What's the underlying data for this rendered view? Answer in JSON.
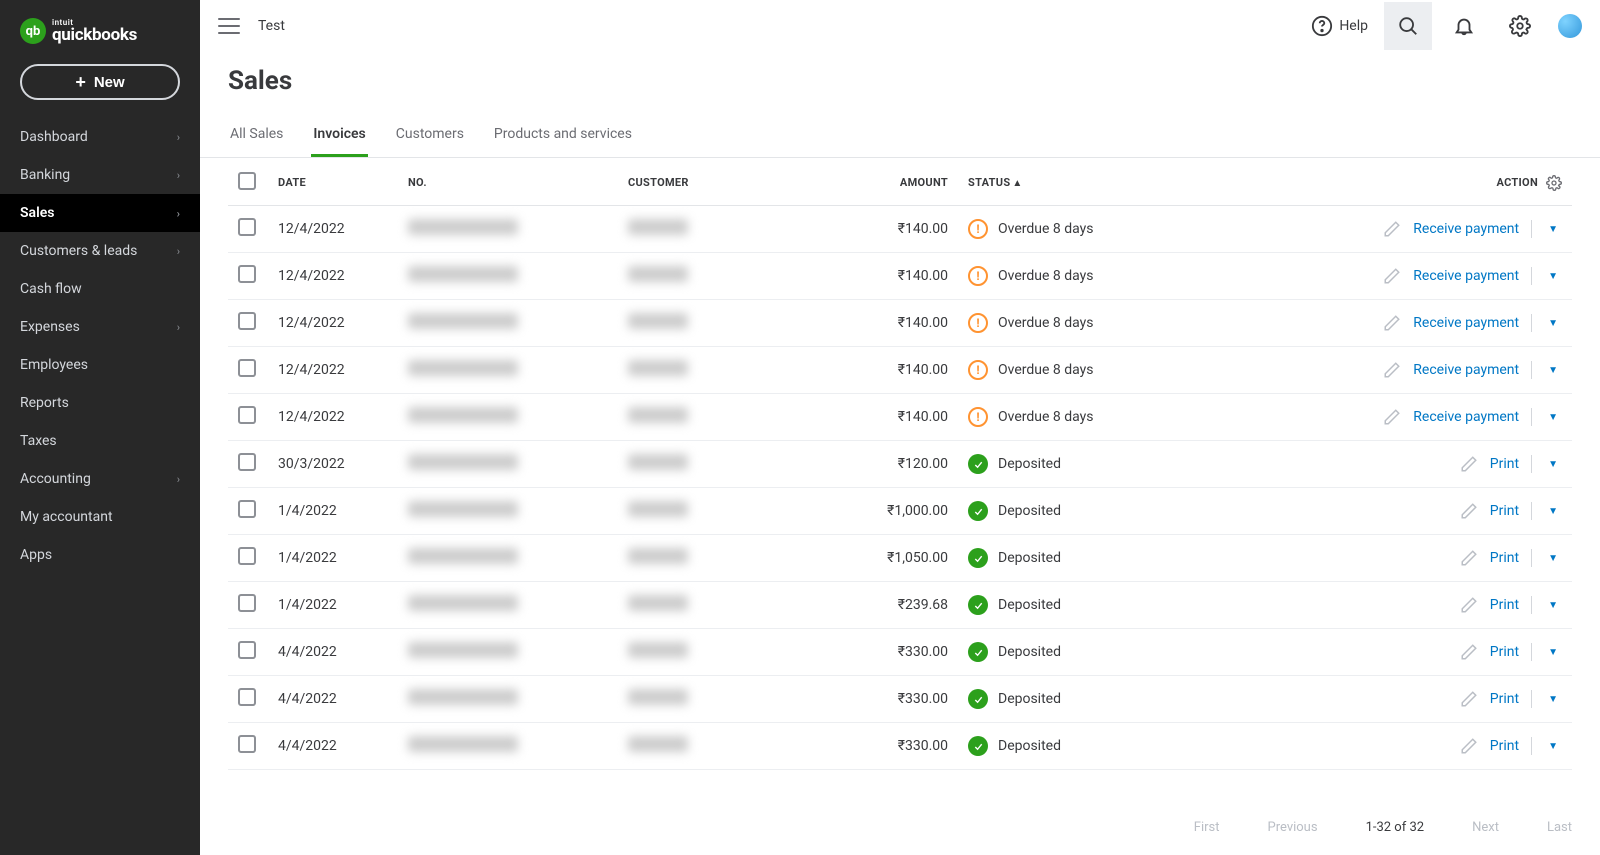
{
  "brand": {
    "intuit": "intuit",
    "product": "quickbooks"
  },
  "newButton": {
    "label": "New"
  },
  "sidebar": {
    "items": [
      {
        "label": "Dashboard",
        "hasSub": true,
        "active": false
      },
      {
        "label": "Banking",
        "hasSub": true,
        "active": false
      },
      {
        "label": "Sales",
        "hasSub": true,
        "active": true
      },
      {
        "label": "Customers & leads",
        "hasSub": true,
        "active": false
      },
      {
        "label": "Cash flow",
        "hasSub": false,
        "active": false
      },
      {
        "label": "Expenses",
        "hasSub": true,
        "active": false
      },
      {
        "label": "Employees",
        "hasSub": false,
        "active": false
      },
      {
        "label": "Reports",
        "hasSub": false,
        "active": false
      },
      {
        "label": "Taxes",
        "hasSub": false,
        "active": false
      },
      {
        "label": "Accounting",
        "hasSub": true,
        "active": false
      },
      {
        "label": "My accountant",
        "hasSub": false,
        "active": false
      },
      {
        "label": "Apps",
        "hasSub": false,
        "active": false
      }
    ]
  },
  "topbar": {
    "company": "Test",
    "help": "Help"
  },
  "page": {
    "title": "Sales"
  },
  "tabs": [
    {
      "label": "All Sales",
      "active": false
    },
    {
      "label": "Invoices",
      "active": true
    },
    {
      "label": "Customers",
      "active": false
    },
    {
      "label": "Products and services",
      "active": false
    }
  ],
  "columns": {
    "date": "DATE",
    "no": "NO.",
    "customer": "CUSTOMER",
    "amount": "AMOUNT",
    "status": "STATUS",
    "action": "ACTION"
  },
  "rows": [
    {
      "date": "12/4/2022",
      "amount": "₹140.00",
      "status": "Overdue 8 days",
      "statusType": "overdue",
      "action": "Receive payment"
    },
    {
      "date": "12/4/2022",
      "amount": "₹140.00",
      "status": "Overdue 8 days",
      "statusType": "overdue",
      "action": "Receive payment"
    },
    {
      "date": "12/4/2022",
      "amount": "₹140.00",
      "status": "Overdue 8 days",
      "statusType": "overdue",
      "action": "Receive payment"
    },
    {
      "date": "12/4/2022",
      "amount": "₹140.00",
      "status": "Overdue 8 days",
      "statusType": "overdue",
      "action": "Receive payment"
    },
    {
      "date": "12/4/2022",
      "amount": "₹140.00",
      "status": "Overdue 8 days",
      "statusType": "overdue",
      "action": "Receive payment"
    },
    {
      "date": "30/3/2022",
      "amount": "₹120.00",
      "status": "Deposited",
      "statusType": "deposited",
      "action": "Print"
    },
    {
      "date": "1/4/2022",
      "amount": "₹1,000.00",
      "status": "Deposited",
      "statusType": "deposited",
      "action": "Print"
    },
    {
      "date": "1/4/2022",
      "amount": "₹1,050.00",
      "status": "Deposited",
      "statusType": "deposited",
      "action": "Print"
    },
    {
      "date": "1/4/2022",
      "amount": "₹239.68",
      "status": "Deposited",
      "statusType": "deposited",
      "action": "Print"
    },
    {
      "date": "4/4/2022",
      "amount": "₹330.00",
      "status": "Deposited",
      "statusType": "deposited",
      "action": "Print"
    },
    {
      "date": "4/4/2022",
      "amount": "₹330.00",
      "status": "Deposited",
      "statusType": "deposited",
      "action": "Print"
    },
    {
      "date": "4/4/2022",
      "amount": "₹330.00",
      "status": "Deposited",
      "statusType": "deposited",
      "action": "Print"
    }
  ],
  "pager": {
    "first": "First",
    "previous": "Previous",
    "range": "1-32 of 32",
    "next": "Next",
    "last": "Last"
  }
}
